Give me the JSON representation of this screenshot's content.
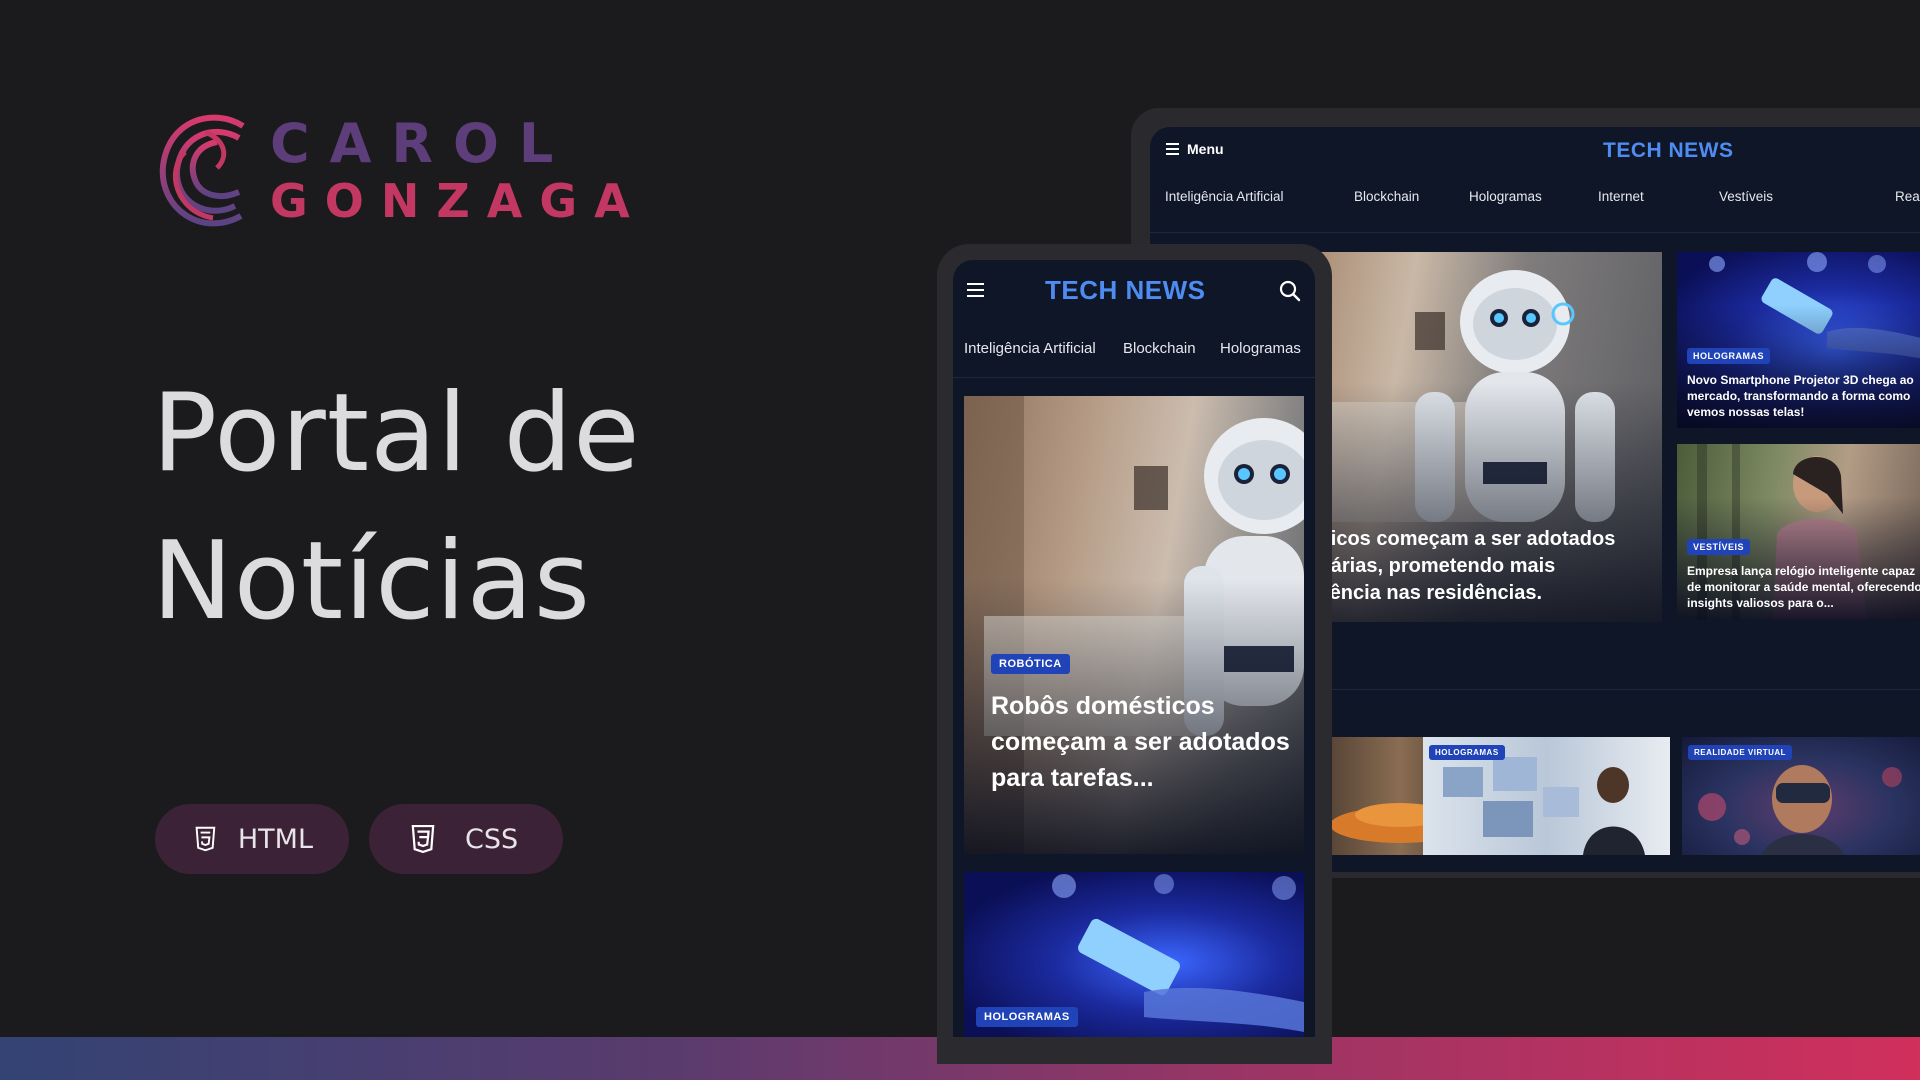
{
  "brand": {
    "line1": "CAROL",
    "line2": "GONZAGA"
  },
  "headline": {
    "line1": "Portal de",
    "line2": "Notícias"
  },
  "badges": [
    {
      "label": "HTML",
      "icon": "html5-icon"
    },
    {
      "label": "CSS",
      "icon": "css3-icon"
    }
  ],
  "colors": {
    "background": "#1b1a1d",
    "brand_purple": "#5d3e7a",
    "brand_pink": "#c33862",
    "badge_bg": "#3c2236",
    "site_bg": "#0f1627",
    "site_logo": "#4f8cf2",
    "tag_bg": "#2143b8"
  },
  "desktop_site": {
    "menu_label": "Menu",
    "logo": "TECH NEWS",
    "nav": [
      "Inteligência Artificial",
      "Blockchain",
      "Hologramas",
      "Internet",
      "Vestíveis",
      "Realid"
    ],
    "hero_title": "sticos começam a ser adotados diárias, prometendo mais ciência nas residências.",
    "hero_title_lines": [
      "sticos começam a ser adotados",
      "diárias, prometendo mais",
      "ciência nas residências."
    ],
    "side_cards": [
      {
        "tag": "HOLOGRAMAS",
        "title": "Novo Smartphone Projetor 3D chega ao mercado, transformando a forma como vemos nossas telas!"
      },
      {
        "tag": "VESTÍVEIS",
        "title": "Empresa lança relógio inteligente capaz de monitorar a saúde mental, oferecendo insights valiosos para o..."
      }
    ],
    "thumbnails": [
      {
        "tag": ""
      },
      {
        "tag": "HOLOGRAMAS"
      },
      {
        "tag": "REALIDADE VIRTUAL"
      }
    ]
  },
  "mobile_site": {
    "logo": "TECH NEWS",
    "nav": [
      "Inteligência Artificial",
      "Blockchain",
      "Hologramas"
    ],
    "hero_tag": "ROBÓTICA",
    "hero_title": "Robôs domésticos começam a ser adotados para tarefas...",
    "second_tag": "HOLOGRAMAS"
  }
}
